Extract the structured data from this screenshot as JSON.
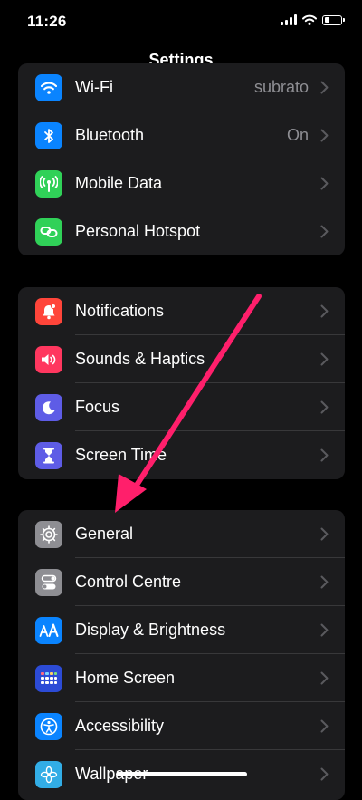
{
  "status": {
    "time": "11:26"
  },
  "nav": {
    "title": "Settings"
  },
  "groups": [
    {
      "items": [
        {
          "label": "Wi-Fi",
          "value": "subrato",
          "icon": "wifi-icon",
          "color": "#0a84ff"
        },
        {
          "label": "Bluetooth",
          "value": "On",
          "icon": "bluetooth-icon",
          "color": "#0a84ff"
        },
        {
          "label": "Mobile Data",
          "value": "",
          "icon": "antenna-icon",
          "color": "#30d158"
        },
        {
          "label": "Personal Hotspot",
          "value": "",
          "icon": "link-icon",
          "color": "#30d158"
        }
      ]
    },
    {
      "items": [
        {
          "label": "Notifications",
          "icon": "bell-icon",
          "color": "#ff453a"
        },
        {
          "label": "Sounds & Haptics",
          "icon": "speaker-icon",
          "color": "#ff375f"
        },
        {
          "label": "Focus",
          "icon": "moon-icon",
          "color": "#5e5ce6"
        },
        {
          "label": "Screen Time",
          "icon": "hourglass-icon",
          "color": "#5e5ce6"
        }
      ]
    },
    {
      "items": [
        {
          "label": "General",
          "icon": "gear-icon",
          "color": "#8e8e93"
        },
        {
          "label": "Control Centre",
          "icon": "toggles-icon",
          "color": "#8e8e93"
        },
        {
          "label": "Display & Brightness",
          "icon": "text-size-icon",
          "color": "#0a84ff"
        },
        {
          "label": "Home Screen",
          "icon": "app-grid-icon",
          "color": "#2c4bd6"
        },
        {
          "label": "Accessibility",
          "icon": "accessibility-icon",
          "color": "#0a84ff"
        },
        {
          "label": "Wallpaper",
          "icon": "flower-icon",
          "color": "#32ade6"
        }
      ]
    }
  ],
  "annotation": {
    "arrow_color": "#ff1f6b"
  }
}
